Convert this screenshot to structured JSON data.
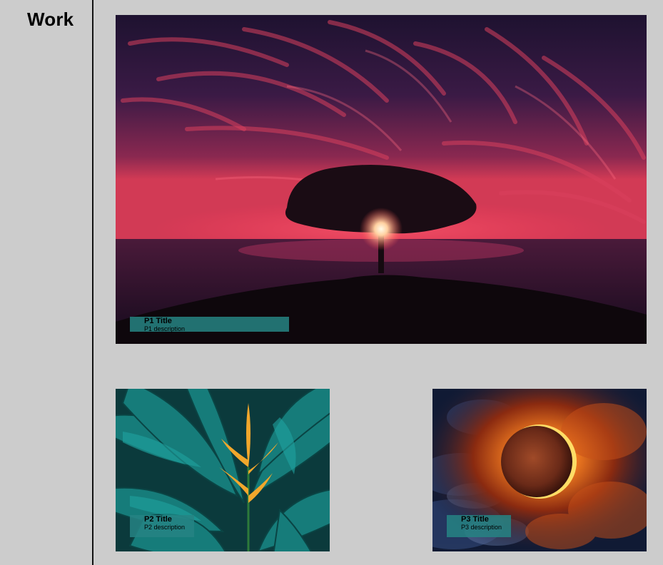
{
  "sidebar": {
    "title": "Work"
  },
  "projects": [
    {
      "title": "P1 Title",
      "description": "P1 description",
      "image": "tree-sunset-photo"
    },
    {
      "title": "P2 Title",
      "description": "P2 description",
      "image": "tropical-leaves-flower-photo"
    },
    {
      "title": "P3 Title",
      "description": "P3 description",
      "image": "solar-eclipse-photo"
    }
  ],
  "colors": {
    "background": "#cccccc",
    "divider": "#111111",
    "caption_bg": "#268484"
  }
}
